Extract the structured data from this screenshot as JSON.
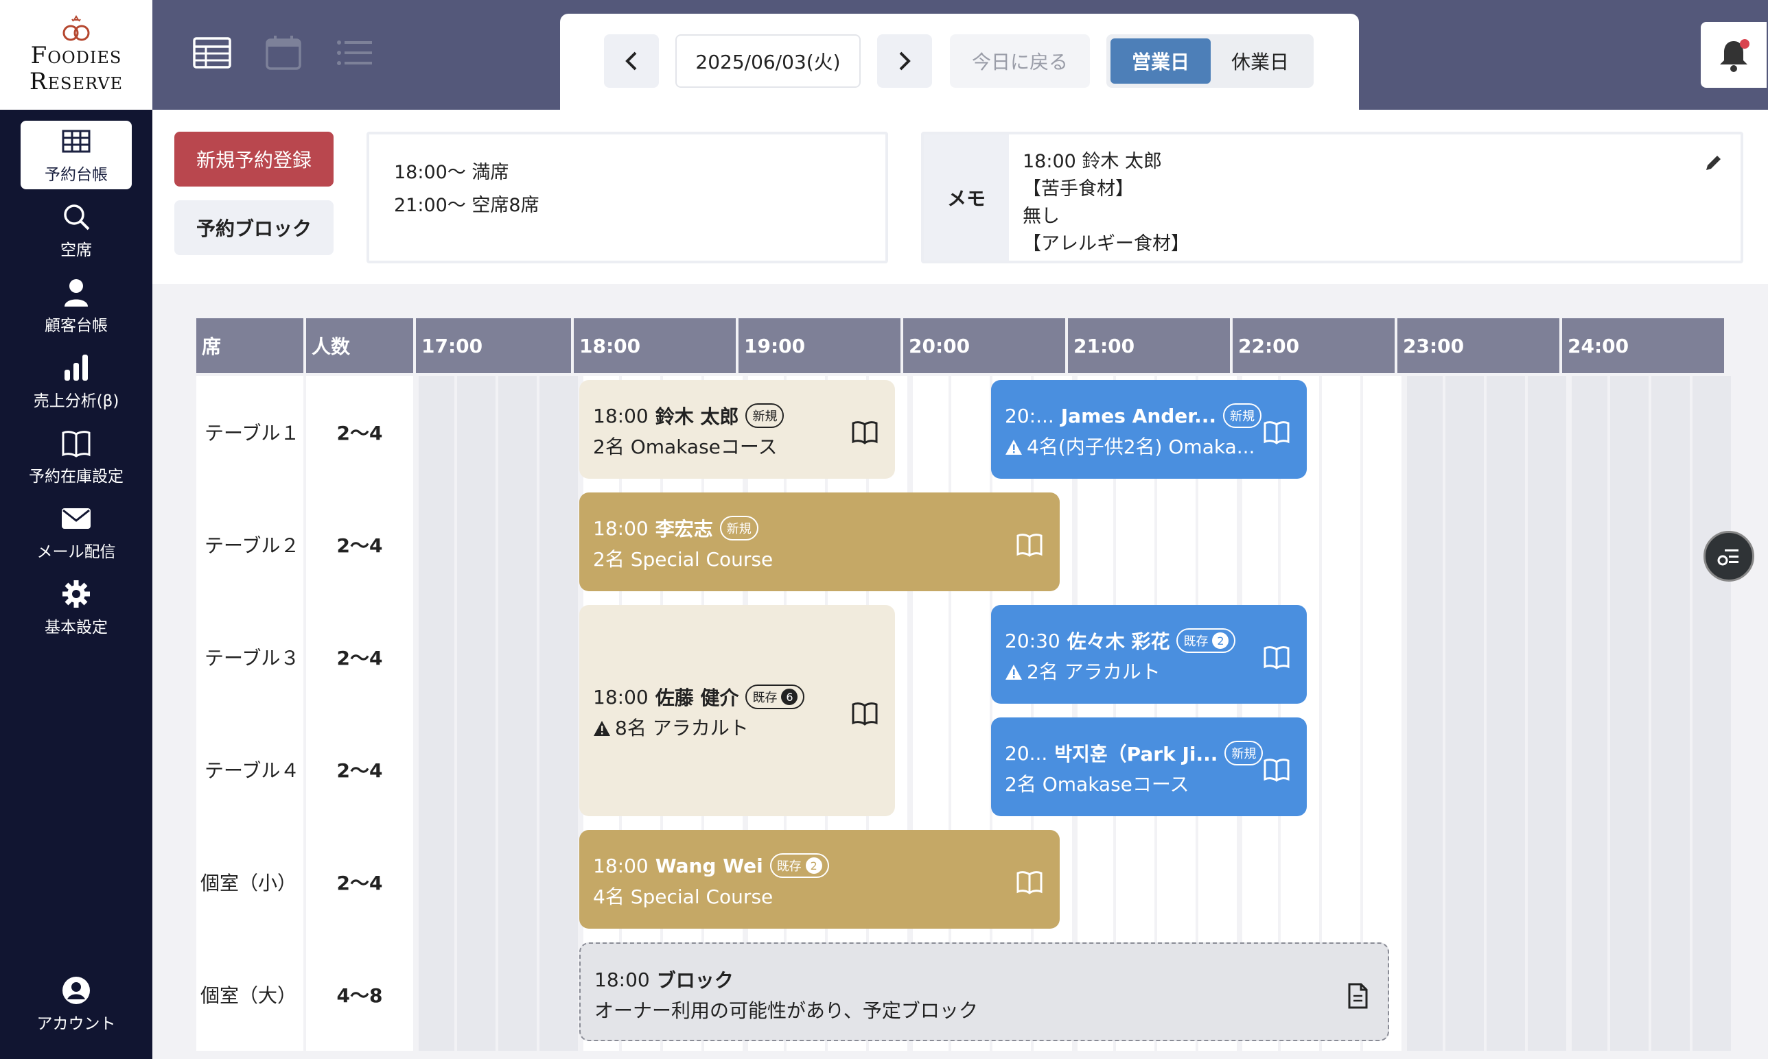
{
  "logo": {
    "line1": "Foodies",
    "line2": "Reserve"
  },
  "sidebar": {
    "items": [
      {
        "label": "予約台帳",
        "icon": "table-icon"
      },
      {
        "label": "空席",
        "icon": "search-icon"
      },
      {
        "label": "顧客台帳",
        "icon": "user-icon"
      },
      {
        "label": "売上分析(β)",
        "icon": "bar-chart-icon"
      },
      {
        "label": "予約在庫設定",
        "icon": "book-icon"
      },
      {
        "label": "メール配信",
        "icon": "mail-icon"
      },
      {
        "label": "基本設定",
        "icon": "gear-icon"
      }
    ],
    "account": "アカウント"
  },
  "header": {
    "date": "2025/06/03(火)",
    "today": "今日に戻る",
    "business_day": "営業日",
    "holiday": "休業日"
  },
  "actions": {
    "new_reservation": "新規予約登録",
    "block": "予約ブロック"
  },
  "summary": {
    "line1": "18:00〜 満席",
    "line2": "21:00〜 空席8席"
  },
  "memo": {
    "label": "メモ",
    "lines": [
      "18:00 鈴木 太郎",
      "【苦手食材】",
      "無し",
      "【アレルギー食材】"
    ]
  },
  "table_header": {
    "seat": "席",
    "people": "人数"
  },
  "hours": [
    "17:00",
    "18:00",
    "19:00",
    "20:00",
    "21:00",
    "22:00",
    "23:00",
    "24:00"
  ],
  "rows": [
    {
      "name": "テーブル１",
      "capacity": "2〜4"
    },
    {
      "name": "テーブル２",
      "capacity": "2〜4"
    },
    {
      "name": "テーブル３",
      "capacity": "2〜4"
    },
    {
      "name": "テーブル４",
      "capacity": "2〜4"
    },
    {
      "name": "個室（小）",
      "capacity": "2〜4"
    },
    {
      "name": "個室（大）",
      "capacity": "4〜8"
    }
  ],
  "reservations": [
    {
      "time": "18:00",
      "name": "鈴木 太郎",
      "badge": "新規",
      "detail": "2名 Omakaseコース"
    },
    {
      "time": "20:...",
      "name": "James Ander...",
      "badge": "新規",
      "detail": "4名(内子供2名) Omaka..."
    },
    {
      "time": "18:00",
      "name": "李宏志",
      "badge": "新規",
      "detail": "2名 Special Course"
    },
    {
      "time": "18:00",
      "name": "佐藤 健介",
      "badge": "既存",
      "count": "6",
      "detail": "8名 アラカルト"
    },
    {
      "time": "20:30",
      "name": "佐々木 彩花",
      "badge": "既存",
      "count": "2",
      "detail": "2名 アラカルト"
    },
    {
      "time": "20...",
      "name": "박지훈（Park Ji...",
      "badge": "新規",
      "detail": "2名 Omakaseコース"
    },
    {
      "time": "18:00",
      "name": "Wang Wei",
      "badge": "既存",
      "count": "2",
      "detail": "4名 Special Course"
    },
    {
      "time": "18:00",
      "name": "ブロック",
      "detail": "オーナー利用の可能性があり、予定ブロック"
    }
  ],
  "colors": {
    "sidebar": "#111531",
    "header": "#54587a",
    "accent_red": "#b9474e",
    "res_cream": "#f1ebdd",
    "res_gold": "#c5a866",
    "res_blue": "#4a8fdf",
    "res_block": "#e3e4e8"
  }
}
